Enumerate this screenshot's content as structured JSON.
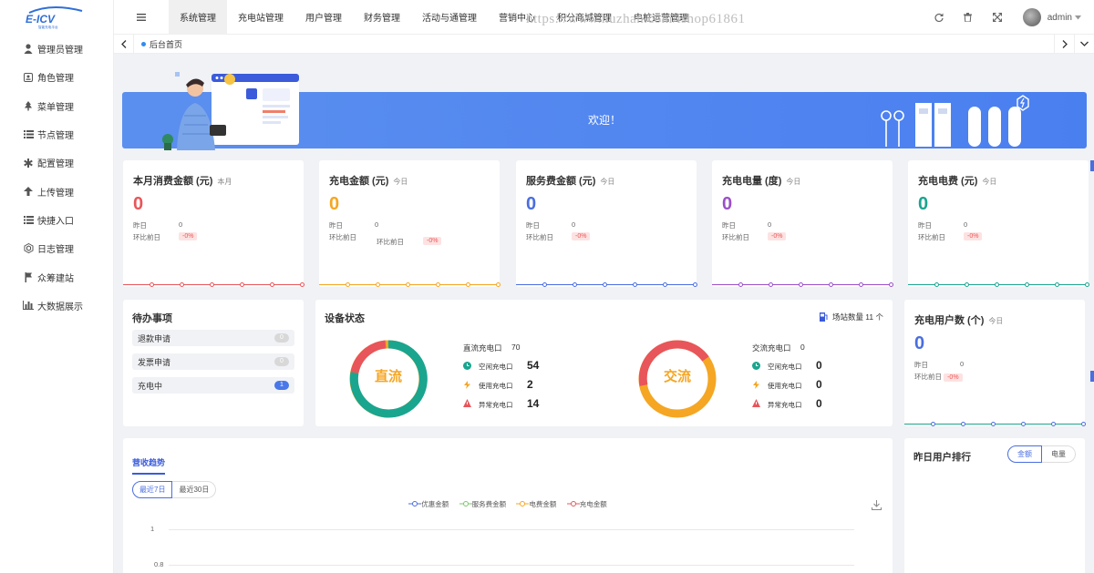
{
  "app": {
    "logo_text": "E-ICV",
    "logo_sub": "智能充电平台"
  },
  "sidebar": {
    "items": [
      {
        "label": "管理员管理",
        "icon": "user-icon"
      },
      {
        "label": "角色管理",
        "icon": "role-icon"
      },
      {
        "label": "菜单管理",
        "icon": "tree-icon"
      },
      {
        "label": "节点管理",
        "icon": "list-icon"
      },
      {
        "label": "配置管理",
        "icon": "asterisk-icon"
      },
      {
        "label": "上传管理",
        "icon": "upload-arrow-icon"
      },
      {
        "label": "快捷入口",
        "icon": "list-icon"
      },
      {
        "label": "日志管理",
        "icon": "log-icon"
      },
      {
        "label": "众筹建站",
        "icon": "flag-icon"
      },
      {
        "label": "大数据展示",
        "icon": "bar-chart-icon"
      }
    ]
  },
  "topbar": {
    "menus": [
      "系统管理",
      "充电站管理",
      "用户管理",
      "财务管理",
      "活动与通管理",
      "营销中心",
      "积分商城管理",
      "电桩运营管理"
    ],
    "active_menu": "系统管理",
    "admin_name": "admin",
    "watermark": "https://www.huzhan.com/ishop61861"
  },
  "tabs": {
    "home": "后台首页"
  },
  "banner": {
    "text": "欢迎！"
  },
  "kpis": [
    {
      "title": "本月消费金额 (元)",
      "tag": "本月",
      "value": "0",
      "color": "#e8555a",
      "yesterday_label": "昨日",
      "yesterday": "0",
      "compare_label": "环比前日",
      "compare": "-0%"
    },
    {
      "title": "充电金额 (元)",
      "tag": "今日",
      "value": "0",
      "color": "#f5a623",
      "yesterday_label": "昨日",
      "yesterday": "0",
      "compare_label": "环比前日",
      "compare": "-0%",
      "extra_label": "环比前日"
    },
    {
      "title": "服务费金额 (元)",
      "tag": "今日",
      "value": "0",
      "color": "#4a6ee0",
      "yesterday_label": "昨日",
      "yesterday": "0",
      "compare_label": "环比前日",
      "compare": "-0%"
    },
    {
      "title": "充电电量 (度)",
      "tag": "今日",
      "value": "0",
      "color": "#9b4fc8",
      "yesterday_label": "昨日",
      "yesterday": "0",
      "compare_label": "环比前日",
      "compare": "-0%"
    },
    {
      "title": "充电电费 (元)",
      "tag": "今日",
      "value": "0",
      "color": "#1aa58f",
      "yesterday_label": "昨日",
      "yesterday": "0",
      "compare_label": "环比前日",
      "compare": "-0%"
    }
  ],
  "todo": {
    "title": "待办事项",
    "items": [
      {
        "label": "退款申请",
        "count": "0"
      },
      {
        "label": "发票申请",
        "count": "0"
      },
      {
        "label": "充电中",
        "count": "1"
      }
    ]
  },
  "devices": {
    "title": "设备状态",
    "station_count_label": "场站数量 11 个",
    "dc": {
      "ring_label": "直流",
      "total_label": "直流充电口",
      "total": "70",
      "idle_label": "空闲充电口",
      "idle": "54",
      "busy_label": "使用充电口",
      "busy": "2",
      "error_label": "异常充电口",
      "error": "14"
    },
    "ac": {
      "ring_label": "交流",
      "total_label": "交流充电口",
      "total": "0",
      "idle_label": "空闲充电口",
      "idle": "0",
      "busy_label": "使用充电口",
      "busy": "0",
      "error_label": "异常充电口",
      "error": "0"
    }
  },
  "users_card": {
    "title": "充电用户数 (个)",
    "tag": "今日",
    "value": "0",
    "color": "#4a6ee0",
    "yesterday_label": "昨日",
    "yesterday": "0",
    "compare_label": "环比前日",
    "compare": "-0%"
  },
  "revenue": {
    "tab": "营收趋势",
    "btn_7": "最近7日",
    "btn_30": "最近30日",
    "legend": [
      {
        "name": "优惠金额",
        "color": "#4a6ee0"
      },
      {
        "name": "服务费金额",
        "color": "#7ac66b"
      },
      {
        "name": "电费金额",
        "color": "#f5a623"
      },
      {
        "name": "充电金额",
        "color": "#e8555a"
      }
    ],
    "y_ticks": [
      "1",
      "0.8"
    ]
  },
  "ranking": {
    "title": "昨日用户排行",
    "btn_amount": "金额",
    "btn_energy": "电量"
  }
}
